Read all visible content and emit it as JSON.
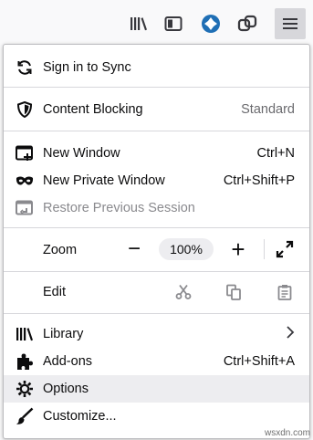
{
  "toolbar": {
    "icons": [
      "library-icon",
      "sidebar-icon",
      "extension-icon",
      "sync-tabs-icon",
      "hamburger-menu-icon"
    ]
  },
  "menu": {
    "sign_in": "Sign in to Sync",
    "content_blocking": {
      "label": "Content Blocking",
      "value": "Standard"
    },
    "new_window": {
      "label": "New Window",
      "shortcut": "Ctrl+N"
    },
    "new_private_window": {
      "label": "New Private Window",
      "shortcut": "Ctrl+Shift+P"
    },
    "restore_session": "Restore Previous Session",
    "zoom": {
      "label": "Zoom",
      "minus": "−",
      "value": "100%",
      "plus": "+"
    },
    "edit": {
      "label": "Edit"
    },
    "library": "Library",
    "addons": {
      "label": "Add-ons",
      "shortcut": "Ctrl+Shift+A"
    },
    "options": "Options",
    "customize": "Customize..."
  },
  "watermark": "wsxdn.com"
}
